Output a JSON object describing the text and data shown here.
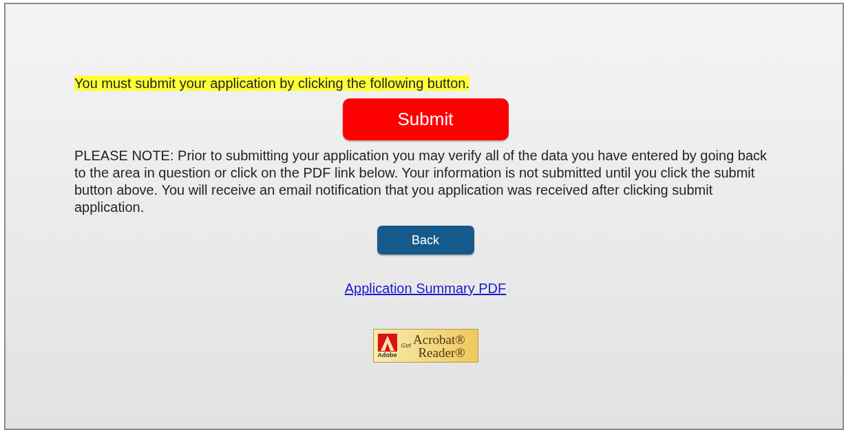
{
  "notice": "You must submit your application by clicking the following button.",
  "submit_button": "Submit",
  "note": "PLEASE NOTE: Prior to submitting your application you may verify all of the data you have entered by going back to the area in question or click on the PDF link below. Your information is not submitted until you click the submit button above. You will receive an email notification that you application was received after clicking submit application.",
  "back_button": "Back",
  "pdf_link": "Application Summary PDF",
  "reader_badge": {
    "brand": "Adobe",
    "get": "Get",
    "line_1": "Acrobat®",
    "line_2": "Reader®"
  }
}
